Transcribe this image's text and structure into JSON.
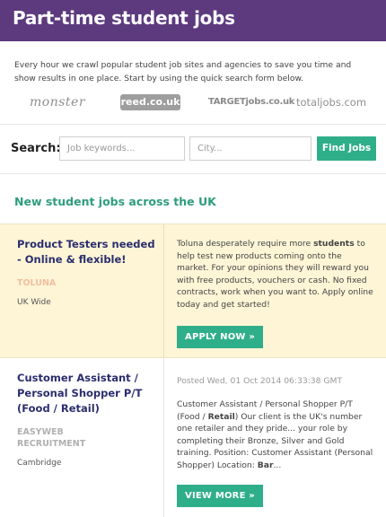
{
  "header": {
    "title": "Part-time student jobs"
  },
  "intro": {
    "text": "Every hour we crawl popular student job sites and agencies to save you time and show results in one place. Start by using the quick search form below."
  },
  "partner_logos": [
    {
      "name": "monster",
      "text": "monster"
    },
    {
      "name": "reed",
      "text": "reed.co.uk"
    },
    {
      "name": "target",
      "text": "TARGETjobs.co.uk"
    },
    {
      "name": "totaljobs",
      "text": "totaljobs.com"
    }
  ],
  "search": {
    "label": "Search:",
    "keywords_placeholder": "Job keywords...",
    "city_placeholder": "City...",
    "button_label": "Find Jobs"
  },
  "section": {
    "heading": "New student jobs across the UK"
  },
  "listings": [
    {
      "title_line1": "Product Testers needed",
      "title_line2": "- Online & flexible!",
      "company": "TOLUNA",
      "location": "UK Wide",
      "desc_before": "Toluna desperately require more ",
      "desc_bold": "students",
      "desc_after": " to help test new products coming onto the market. For your opinions they will reward you with free products, vouchers or cash. No fixed contracts, work when you want to. Apply online today and get started!",
      "button_label": "APPLY NOW »"
    },
    {
      "title_line1": "Customer Assistant /",
      "title_line2": "Personal Shopper  P/T",
      "title_line3": "(Food / Retail)",
      "company_line1": "EASYWEB",
      "company_line2": "RECRUITMENT",
      "location": "Cambridge",
      "posted": "Posted Wed, 01 Oct 2014 06:33:38 GMT",
      "desc_before": "Customer Assistant / Personal Shopper  P/T (Food / ",
      "desc_bold": "Retail",
      "desc_mid": ") Our client is the UK's number one retailer and they pride... your role by completing their Bronze, Silver and Gold training. Position: Customer Assistant (Personal Shopper) Location: ",
      "desc_bold2": "Bar",
      "desc_after": "...",
      "button_label": "VIEW MORE »"
    }
  ],
  "colors": {
    "header_bg": "#5d3a7e",
    "accent_green": "#2fae8a",
    "title_navy": "#2b2e6e",
    "featured_bg": "#fdf5d6",
    "company_peach": "#f3bfa0"
  }
}
